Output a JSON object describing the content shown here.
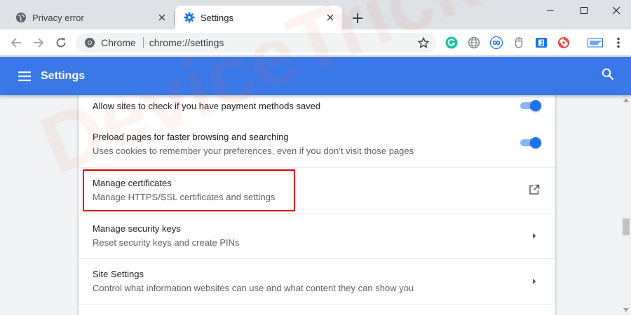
{
  "tabs": [
    {
      "title": "Privacy error",
      "active": false
    },
    {
      "title": "Settings",
      "active": true
    }
  ],
  "omnibox": {
    "site_chip": "Chrome",
    "url": "chrome://settings"
  },
  "extensions": [
    "grammarly-icon",
    "globe-extension-icon",
    "infinity-extension-icon",
    "mouse-extension-icon",
    "bracket-extension-icon",
    "spiral-extension-icon",
    "badge-extension-icon"
  ],
  "header": {
    "title": "Settings"
  },
  "rows": [
    {
      "primary": "Allow sites to check if you have payment methods saved",
      "secondary": "",
      "control": "toggle",
      "on": true
    },
    {
      "primary": "Preload pages for faster browsing and searching",
      "secondary": "Uses cookies to remember your preferences, even if you don’t visit those pages",
      "control": "toggle",
      "on": true
    },
    {
      "primary": "Manage certificates",
      "secondary": "Manage HTTPS/SSL certificates and settings",
      "control": "open-external"
    },
    {
      "primary": "Manage security keys",
      "secondary": "Reset security keys and create PINs",
      "control": "chevron"
    },
    {
      "primary": "Site Settings",
      "secondary": "Control what information websites can use and what content they can show you",
      "control": "chevron"
    }
  ],
  "watermark": "DeviceTricks",
  "colors": {
    "header_blue": "#3b78e7",
    "toggle_blue": "#1a73e8",
    "highlight_red": "#e00000"
  }
}
